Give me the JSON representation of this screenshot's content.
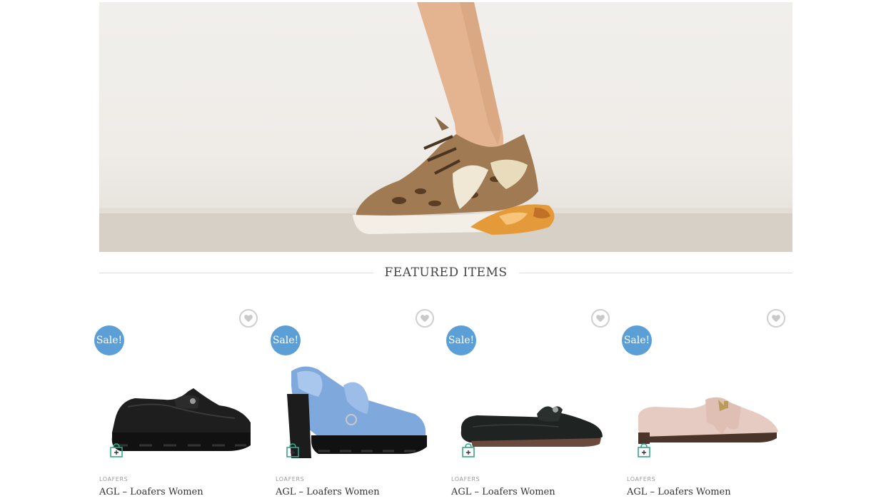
{
  "section": {
    "title": "FEATURED ITEMS"
  },
  "products": [
    {
      "category": "LOAFERS",
      "name": "AGL – Loafers Women",
      "badge": "Sale!",
      "color": "black-lug"
    },
    {
      "category": "LOAFERS",
      "name": "AGL – Loafers Women",
      "badge": "Sale!",
      "color": "blue-heel"
    },
    {
      "category": "LOAFERS",
      "name": "AGL – Loafers Women",
      "badge": "Sale!",
      "color": "black-flat"
    },
    {
      "category": "LOAFERS",
      "name": "AGL – Loafers Women",
      "badge": "Sale!",
      "color": "pink-fringe"
    }
  ],
  "colors": {
    "sale_badge": "#5c9fd6",
    "cart_icon": "#3aa58a",
    "divider": "#d9dde3"
  },
  "icons": {
    "wishlist": "heart-icon",
    "cart": "shopping-bag-plus-icon"
  }
}
